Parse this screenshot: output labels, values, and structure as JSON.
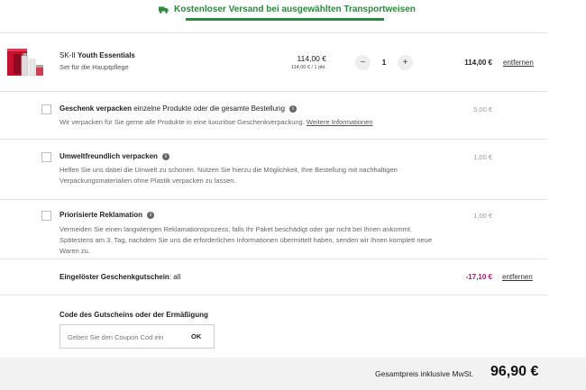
{
  "shipping": {
    "icon": "truck-icon",
    "text": "Kostenloser Versand bei ausgewählten Transportweisen",
    "color": "#2b8a3e"
  },
  "product": {
    "brand": "SK-II",
    "name": "Youth Essentials",
    "subtitle": "Set für die Hauptpflege",
    "price": "114,00 €",
    "unit_price": "114,00 € / 1 pkt.",
    "quantity": "1",
    "minus_label": "−",
    "plus_label": "+",
    "total": "114,00 €",
    "remove_label": "entfernen"
  },
  "options": [
    {
      "title": "Geschenk verpacken",
      "title_suffix": " einzelne Produkte oder die gesamte Bestellung",
      "description": "Wir verpacken für Sie gerne alle Produkte in eine luxuriöse Geschenkverpackung.",
      "link": "Weitere Informationen",
      "price": "5,00 €",
      "checked": false
    },
    {
      "title": "Umweltfreundlich verpacken",
      "description": "Helfen Sie uns dabei die Umwelt zu schonen. Nutzen Sie hierzu die Möglichkeit, Ihre Bestellung mit nachhaltigen Verpackungsmaterialien ohne Plastik verpacken zu lassen.",
      "price": "1,00 €",
      "checked": false
    },
    {
      "title": "Priorisierte Reklamation",
      "description": "Vermeiden Sie einen langwierigen Reklamationsprozess, falls Ihr Paket beschädigt oder gar nicht bei Ihnen ankommt. Spätestens am 3. Tag, nachdem Sie uns die erforderlichen Informationen übermittelt haben, senden wir Ihnen komplett neue Waren zu.",
      "price": "1,00 €",
      "checked": false
    }
  ],
  "voucher": {
    "label": "Eingelöster Geschenkgutschein",
    "suffix": ": all",
    "amount": "-17,10 €",
    "remove_label": "entfernen",
    "amount_color": "#b01a6a"
  },
  "coupon": {
    "title": "Code des Gutscheins oder der Ermäßigung",
    "placeholder": "Geben Sie den Coupon Cod ein",
    "value": "",
    "ok_label": "OK"
  },
  "total": {
    "label": "Gesamtpreis inklusive MwSt.",
    "value": "96,90 €"
  }
}
